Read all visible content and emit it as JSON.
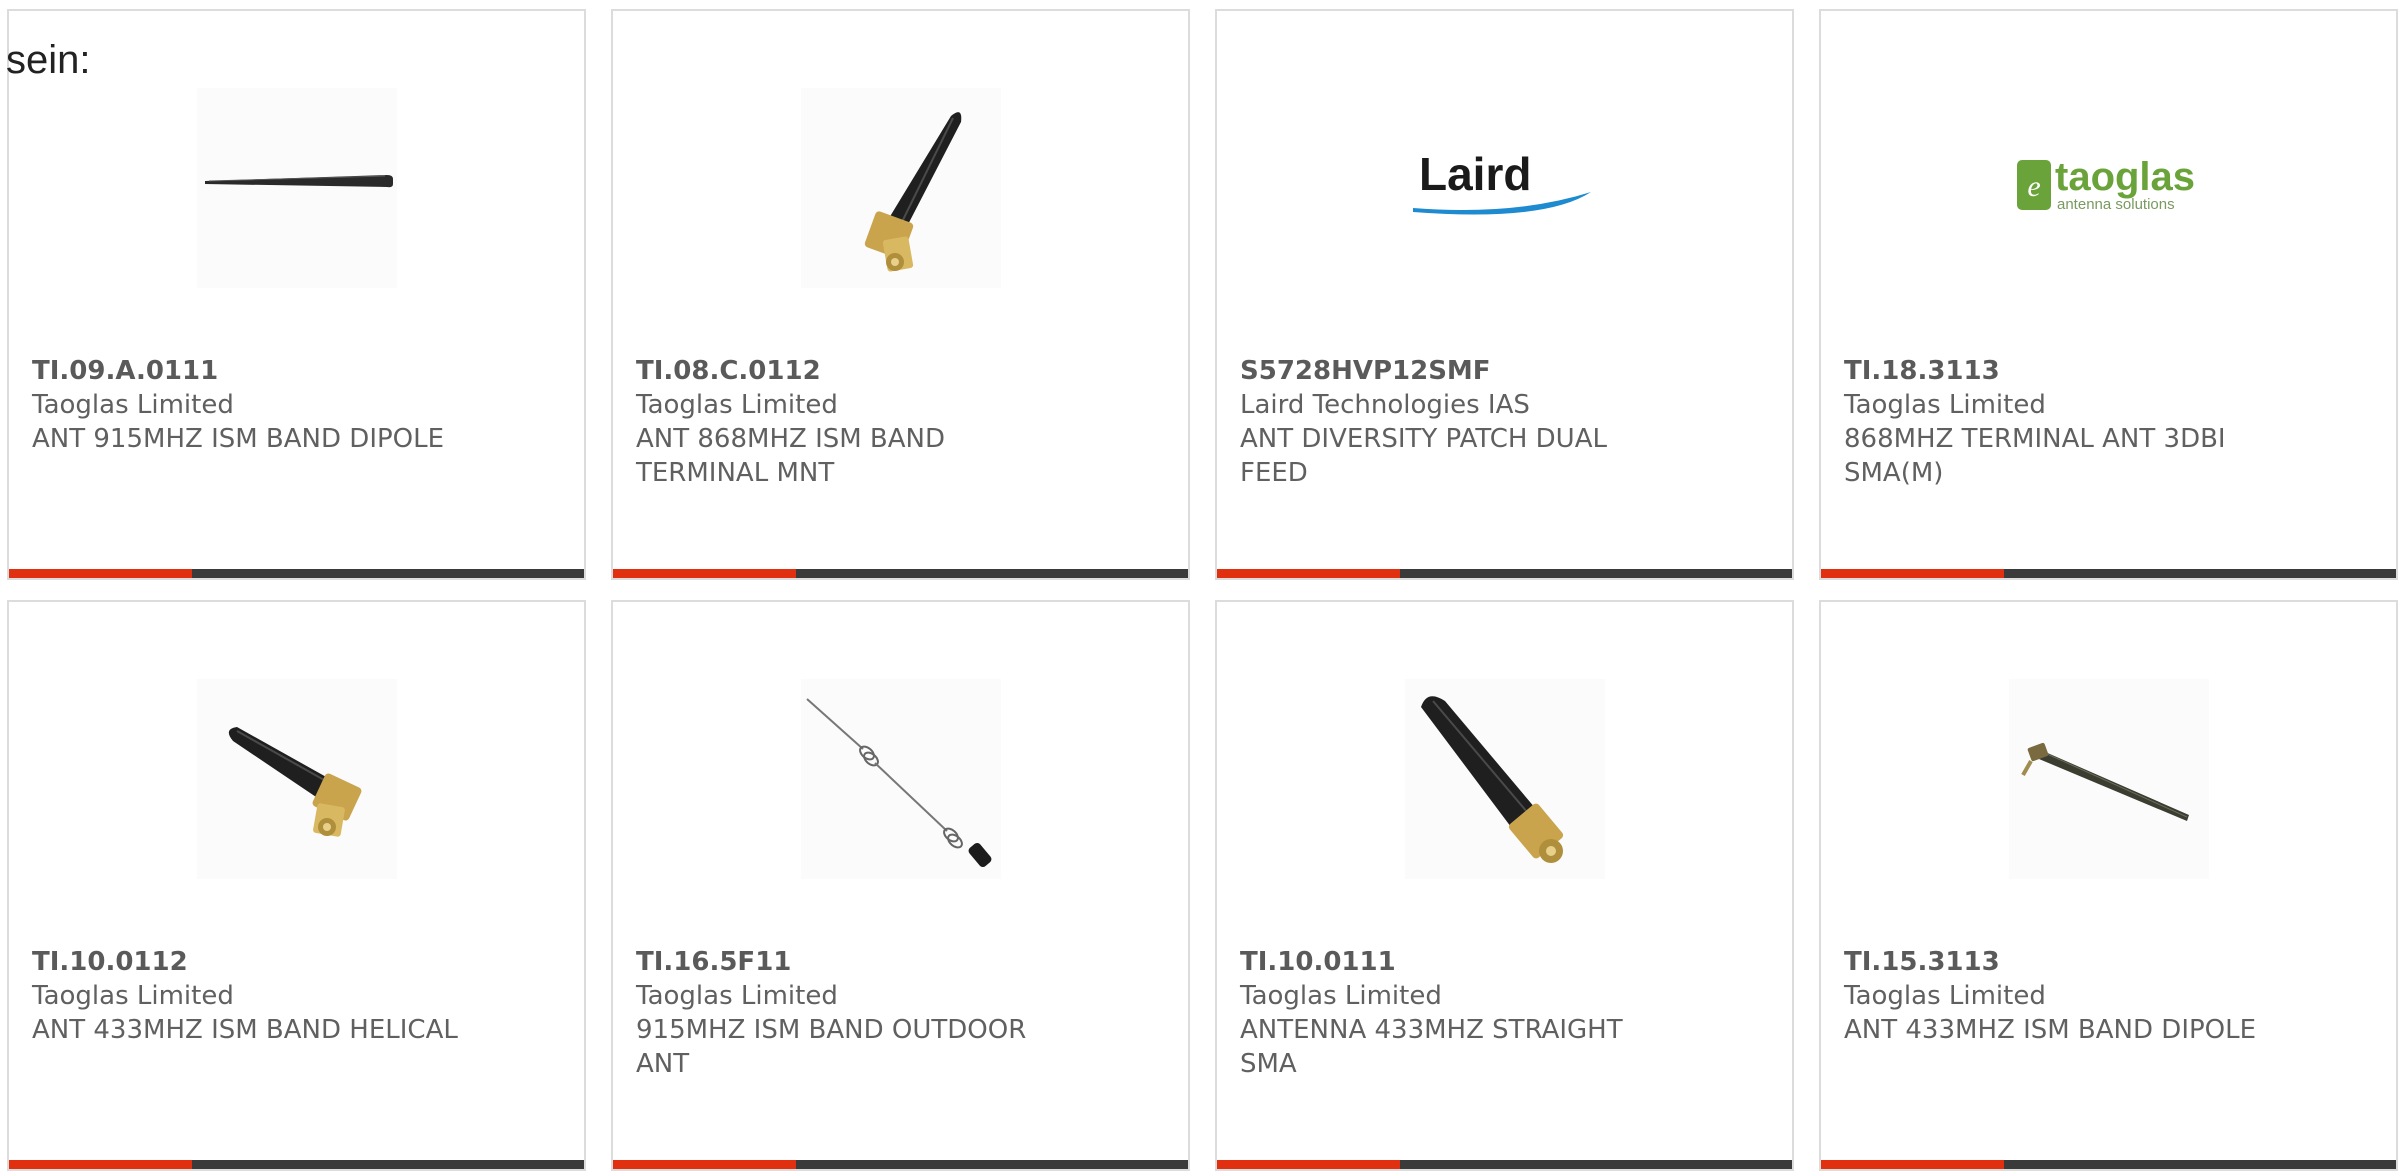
{
  "page": {
    "lead_text": "sein:"
  },
  "colors": {
    "card_border": "#dcdcdc",
    "text": "#606060",
    "accent_bar": "#e03010",
    "dark_bar": "#3a3a3a",
    "laird_blue": "#1e8ad0",
    "taoglas_green": "#6aa33a"
  },
  "products": [
    {
      "part_number": "TI.09.A.0111",
      "manufacturer": "Taoglas Limited",
      "description_line1": "ANT 915MHZ ISM BAND DIPOLE",
      "description_line2": "",
      "image": "straight-whip-antenna-icon"
    },
    {
      "part_number": "TI.08.C.0112",
      "manufacturer": "Taoglas Limited",
      "description_line1": "ANT 868MHZ ISM BAND",
      "description_line2": "TERMINAL MNT",
      "image": "right-angle-sma-antenna-icon"
    },
    {
      "part_number": "S5728HVP12SMF",
      "manufacturer": "Laird Technologies IAS",
      "description_line1": "ANT DIVERSITY PATCH DUAL",
      "description_line2": "FEED",
      "image": "laird-logo",
      "logo_text": "Laird"
    },
    {
      "part_number": "TI.18.3113",
      "manufacturer": "Taoglas Limited",
      "description_line1": "868MHZ TERMINAL ANT 3DBI",
      "description_line2": "SMA(M)",
      "image": "taoglas-logo",
      "logo_text": "taoglas",
      "logo_tagline": "antenna solutions"
    },
    {
      "part_number": "TI.10.0112",
      "manufacturer": "Taoglas Limited",
      "description_line1": "ANT 433MHZ ISM BAND HELICAL",
      "description_line2": "",
      "image": "right-angle-sma-antenna-icon"
    },
    {
      "part_number": "TI.16.5F11",
      "manufacturer": "Taoglas Limited",
      "description_line1": "915MHZ ISM BAND OUTDOOR",
      "description_line2": "ANT",
      "image": "coiled-wire-antenna-icon"
    },
    {
      "part_number": "TI.10.0111",
      "manufacturer": "Taoglas Limited",
      "description_line1": "ANTENNA 433MHZ STRAIGHT",
      "description_line2": "SMA",
      "image": "straight-sma-antenna-icon"
    },
    {
      "part_number": "TI.15.3113",
      "manufacturer": "Taoglas Limited",
      "description_line1": "ANT 433MHZ ISM BAND DIPOLE",
      "description_line2": "",
      "image": "hinged-dipole-antenna-icon"
    }
  ]
}
